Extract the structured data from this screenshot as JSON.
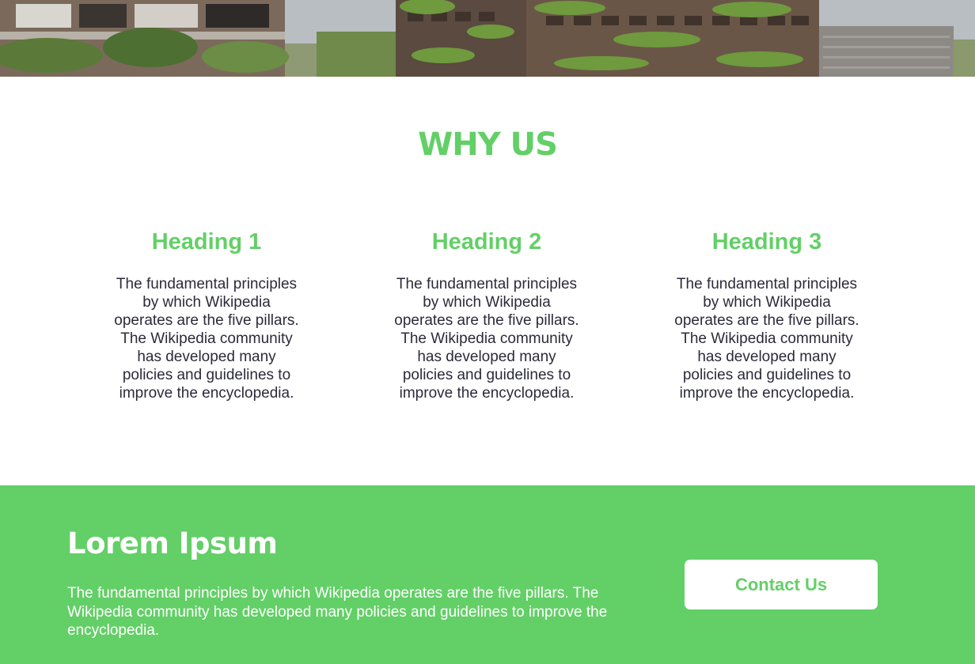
{
  "hero": {
    "image_desc": "Green vertical-forest residential towers"
  },
  "why_us": {
    "title": "WHY US",
    "features": [
      {
        "heading": "Heading 1",
        "text": "The fundamental principles by which Wikipedia operates are the five pillars. The Wikipedia community has developed many policies and guidelines to improve the encyclopedia."
      },
      {
        "heading": "Heading 2",
        "text": "The fundamental principles by which Wikipedia operates are the five pillars. The Wikipedia community has developed many policies and guidelines to improve the encyclopedia."
      },
      {
        "heading": "Heading 3",
        "text": "The fundamental principles by which Wikipedia operates are the five pillars. The Wikipedia community has developed many policies and guidelines to improve the encyclopedia."
      }
    ]
  },
  "cta": {
    "title": "Lorem Ipsum",
    "text": "The fundamental principles by which Wikipedia operates are the five pillars. The Wikipedia community has developed many policies and guidelines to improve the encyclopedia.",
    "button_label": "Contact Us"
  },
  "colors": {
    "accent": "#63cf67",
    "body_text": "#2b2b3a",
    "background": "#ffffff"
  }
}
